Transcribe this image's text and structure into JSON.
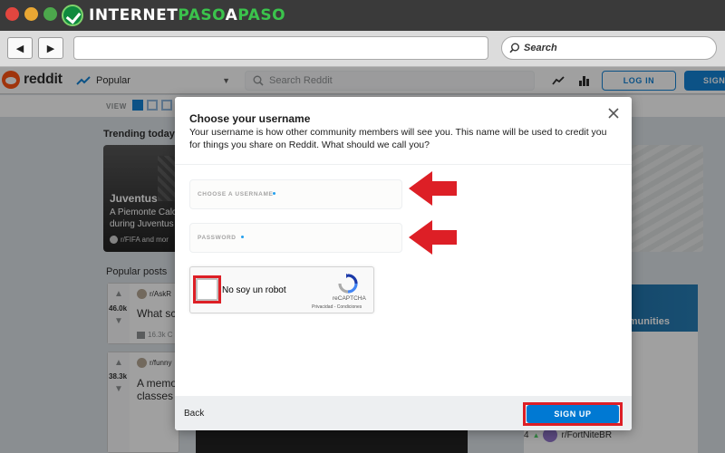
{
  "brand": {
    "text_part1": "INTERNET",
    "text_part2": "PASO",
    "text_part3": "A",
    "text_part4": "PASO"
  },
  "browser": {
    "back_label": "◀",
    "forward_label": "▶",
    "search_placeholder": "Search"
  },
  "reddit": {
    "logo_text": "reddit",
    "feed_label": "Popular",
    "search_placeholder": "Search Reddit",
    "login_label": "LOG IN",
    "signup_label": "SIGN",
    "view_label": "VIEW",
    "trending_title": "Trending today",
    "trend_card": {
      "title": "Juventus",
      "desc_line1": "A Piemonte Calc",
      "desc_line2": "during Juventus",
      "sub": "r/FIFA and mor"
    },
    "popular_title": "Popular posts",
    "posts": [
      {
        "subreddit": "r/AskR",
        "score": "46.0k",
        "title": "What sc",
        "comments": "16.3k C"
      },
      {
        "subreddit": "r/funny",
        "score": "38.3k",
        "title_line1": "A memo",
        "title_line2": "classes"
      }
    ],
    "communities_label": "mmunities",
    "community_header": "ch",
    "community_row": {
      "rank": "4",
      "name": "r/FortNiteBR"
    }
  },
  "modal": {
    "title": "Choose your username",
    "description": "Your username is how other community members will see you. This name will be used to credit you for things you share on Reddit. What should we call you?",
    "username_label": "CHOOSE A USERNAME",
    "password_label": "PASSWORD",
    "captcha": {
      "label": "No soy un robot",
      "brand": "reCAPTCHA",
      "terms": "Privacidad - Condiciones"
    },
    "back_label": "Back",
    "signup_label": "SIGN UP"
  },
  "colors": {
    "reddit_orange": "#ff4500",
    "reddit_blue": "#0079d3",
    "highlight_red": "#dd1f26",
    "brand_green": "#3bc34c"
  }
}
